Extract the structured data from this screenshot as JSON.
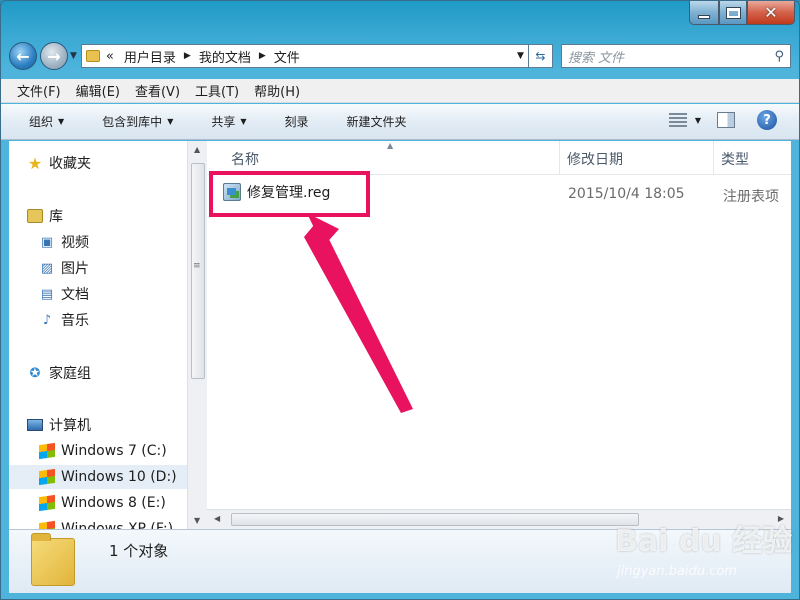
{
  "address": {
    "crumbs": [
      "用户目录",
      "我的文档",
      "文件"
    ],
    "overflow": "«",
    "search_placeholder": "搜索 文件"
  },
  "menu": [
    "文件(F)",
    "编辑(E)",
    "查看(V)",
    "工具(T)",
    "帮助(H)"
  ],
  "commands": {
    "organize": "组织",
    "include": "包含到库中",
    "share": "共享",
    "burn": "刻录",
    "new_folder": "新建文件夹"
  },
  "nav": {
    "favorites": "收藏夹",
    "libraries": "库",
    "videos": "视频",
    "pictures": "图片",
    "documents": "文档",
    "music": "音乐",
    "homegroup": "家庭组",
    "computer": "计算机",
    "drives": [
      "Windows 7 (C:)",
      "Windows 10 (D:)",
      "Windows 8 (E:)",
      "Windows XP (F:)"
    ]
  },
  "columns": {
    "name": "名称",
    "modified": "修改日期",
    "type": "类型"
  },
  "file": {
    "name": "修复管理.reg",
    "modified": "2015/10/4 18:05",
    "type": "注册表项"
  },
  "status": {
    "count": "1 个对象"
  },
  "watermark": {
    "brand": "Bai du 经验",
    "url": "jingyan.baidu.com"
  },
  "colors": {
    "highlight": "#e8125e",
    "accent": "#2b7fc2"
  }
}
